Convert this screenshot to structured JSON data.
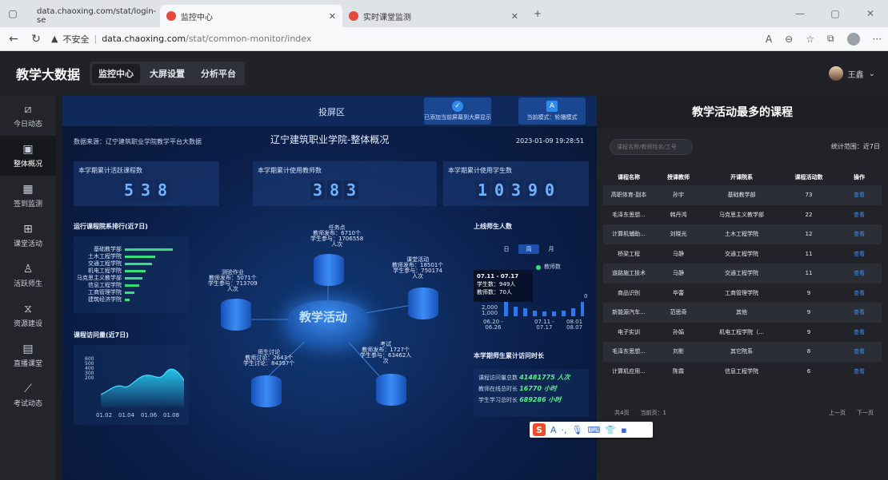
{
  "browser": {
    "tabs": [
      {
        "title": "data.chaoxing.com/stat/login-se"
      },
      {
        "title": "监控中心"
      },
      {
        "title": "实时课堂监测"
      }
    ],
    "url": {
      "warning": "不安全",
      "host": "data.chaoxing.com",
      "path": "/stat/common-monitor/index"
    }
  },
  "app": {
    "brand": "教学大数据",
    "nav": [
      "监控中心",
      "大屏设置",
      "分析平台"
    ],
    "user": "王鑫"
  },
  "sidebar": {
    "items": [
      {
        "label": "今日动态",
        "icon": "chart-icon"
      },
      {
        "label": "整体概况",
        "icon": "overview-icon"
      },
      {
        "label": "签到监测",
        "icon": "calendar-icon"
      },
      {
        "label": "课堂活动",
        "icon": "grid-icon"
      },
      {
        "label": "活跃师生",
        "icon": "person-icon"
      },
      {
        "label": "资源建设",
        "icon": "hourglass-icon"
      },
      {
        "label": "直播课堂",
        "icon": "document-icon"
      },
      {
        "label": "考试动态",
        "icon": "line-chart-icon"
      }
    ]
  },
  "dashboard": {
    "projection": "投屏区",
    "added_label": "已添加当前屏幕到大屏显示",
    "mode_label": "当前模式：轮播模式",
    "source": "数据来源：辽宁建筑职业学院教学平台大数据",
    "title": "辽宁建筑职业学院-整体概况",
    "timestamp": "2023-01-09 19:28:51",
    "stats": [
      {
        "label": "本学期累计活跃课程数",
        "digits": [
          "5",
          "3",
          "8"
        ]
      },
      {
        "label": "本学期累计使用教师数",
        "digits": [
          "3",
          "8",
          "3"
        ]
      },
      {
        "label": "本学期累计使用学生数",
        "digits": [
          "1",
          "0",
          "3",
          "9",
          "0"
        ]
      }
    ],
    "dept_title": "运行课程院系排行(近7日)",
    "departments": [
      {
        "name": "基础教学部",
        "value": 60
      },
      {
        "name": "土木工程学院",
        "value": 38
      },
      {
        "name": "交通工程学院",
        "value": 34
      },
      {
        "name": "机电工程学院",
        "value": 26
      },
      {
        "name": "马克思主义教学部",
        "value": 22
      },
      {
        "name": "信息工程学院",
        "value": 18
      },
      {
        "name": "工商管理学院",
        "value": 12
      },
      {
        "name": "建筑经济学院",
        "value": 6
      }
    ],
    "visit_title": "课程访问量(近7日)",
    "visit_y_ticks": [
      "600",
      "500",
      "400",
      "300",
      "200"
    ],
    "visit_x_ticks": [
      "01.02",
      "01.04",
      "01.06",
      "01.08"
    ],
    "center": "教学活动",
    "nodes": {
      "task": {
        "title": "任务点",
        "line1": "教师发布：6710个",
        "line2": "学生参与：1706558",
        "line3": "人次"
      },
      "homework": {
        "title": "测验作业",
        "line1": "教师发布：5071个",
        "line2": "学生参与：713709",
        "line3": "人次"
      },
      "class": {
        "title": "课堂活动",
        "line1": "教师发布：18501个",
        "line2": "学生参与：750174",
        "line3": "人次"
      },
      "discuss": {
        "title": "师生讨论",
        "line1": "教师讨论：2643个",
        "line2": "学生讨论：84397个"
      },
      "exam": {
        "title": "考试",
        "line1": "教师发布：1727个",
        "line2": "学生参与：63462人",
        "line3": "次"
      }
    },
    "online_title": "上线师生人数",
    "segments": [
      "日",
      "周",
      "月"
    ],
    "online_legend": "教师数",
    "tooltip": {
      "range": "07.11 - 07.17",
      "students": "学生数：949人",
      "teachers": "教师数：70人"
    },
    "online_y_ticks": [
      "2,000",
      "1,000",
      "0"
    ],
    "online_x_ticks": [
      {
        "a": "06.20 -",
        "b": "06.26"
      },
      {
        "a": "07.11 -",
        "b": "07.17"
      },
      {
        "a": "08.01",
        "b": "08.07"
      }
    ],
    "accum_title": "本学期师生累计访问时长",
    "accum": [
      {
        "label": "课程访问量总数",
        "value": "41481775 人次"
      },
      {
        "label": "教师在线总时长",
        "value": "16770 小时"
      },
      {
        "label": "学生学习总时长",
        "value": "689286 小时"
      }
    ]
  },
  "ranking": {
    "title": "教学活动最多的课程",
    "search_placeholder": "课程名称/教师姓名/工号",
    "range_label": "统计范围：近7日",
    "headers": [
      "课程名称",
      "授课教师",
      "开课院系",
      "课程活动数",
      "操作"
    ],
    "rows": [
      {
        "course": "高职体育-副本",
        "teacher": "孙宇",
        "dept": "基础教学部",
        "count": "73",
        "action": "查看"
      },
      {
        "course": "毛泽东思想...",
        "teacher": "韩丹鸿",
        "dept": "马克思主义教学部",
        "count": "22",
        "action": "查看"
      },
      {
        "course": "计算机辅助...",
        "teacher": "刘晓光",
        "dept": "土木工程学院",
        "count": "12",
        "action": "查看"
      },
      {
        "course": "桥梁工程",
        "teacher": "马静",
        "dept": "交通工程学院",
        "count": "11",
        "action": "查看"
      },
      {
        "course": "道路施工技术",
        "teacher": "马静",
        "dept": "交通工程学院",
        "count": "11",
        "action": "查看"
      },
      {
        "course": "商品识别",
        "teacher": "毕蕾",
        "dept": "工商管理学院",
        "count": "9",
        "action": "查看"
      },
      {
        "course": "新能源汽车...",
        "teacher": "范思奇",
        "dept": "其他",
        "count": "9",
        "action": "查看"
      },
      {
        "course": "电子实训",
        "teacher": "孙娟",
        "dept": "机电工程学院（...",
        "count": "9",
        "action": "查看"
      },
      {
        "course": "毛泽东思想...",
        "teacher": "刘影",
        "dept": "其它院系",
        "count": "8",
        "action": "查看"
      },
      {
        "course": "计算机应用...",
        "teacher": "陈霖",
        "dept": "信息工程学院",
        "count": "6",
        "action": "查看"
      }
    ],
    "pager": {
      "total": "共4页",
      "current": "当前页：1",
      "prev": "上一页",
      "next": "下一页"
    }
  },
  "ime": {
    "letter": "A"
  }
}
